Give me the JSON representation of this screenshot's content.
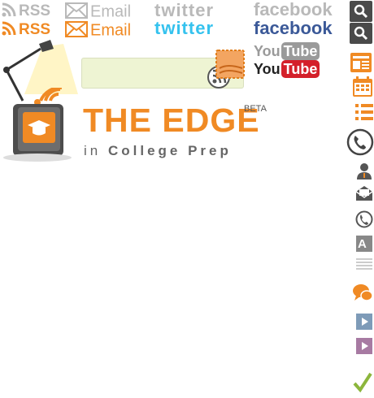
{
  "social": {
    "rss": "RSS",
    "email": "Email",
    "twitter": "twitter",
    "facebook": "facebook",
    "youtube_you": "You",
    "youtube_tube": "Tube"
  },
  "search": {
    "value": "",
    "placeholder": ""
  },
  "logo": {
    "title": "THE EDGE",
    "beta": "BETA",
    "subtitle_prefix": "in",
    "subtitle": "College Prep"
  },
  "colors": {
    "brand_orange": "#f08a24",
    "twitter": "#35c2ee",
    "facebook": "#3b5998",
    "youtube_red": "#d4202a",
    "toolbar_orange": "#f08a24"
  },
  "toolbar_icons": [
    "search-icon",
    "search-icon",
    "news-icon",
    "calendar-icon",
    "list-icon",
    "phone-circle-icon",
    "person-icon",
    "mail-open-icon",
    "phone-icon",
    "font-size-icon",
    "lines-icon",
    "chat-icon",
    "play-icon",
    "play-icon",
    "check-icon"
  ]
}
